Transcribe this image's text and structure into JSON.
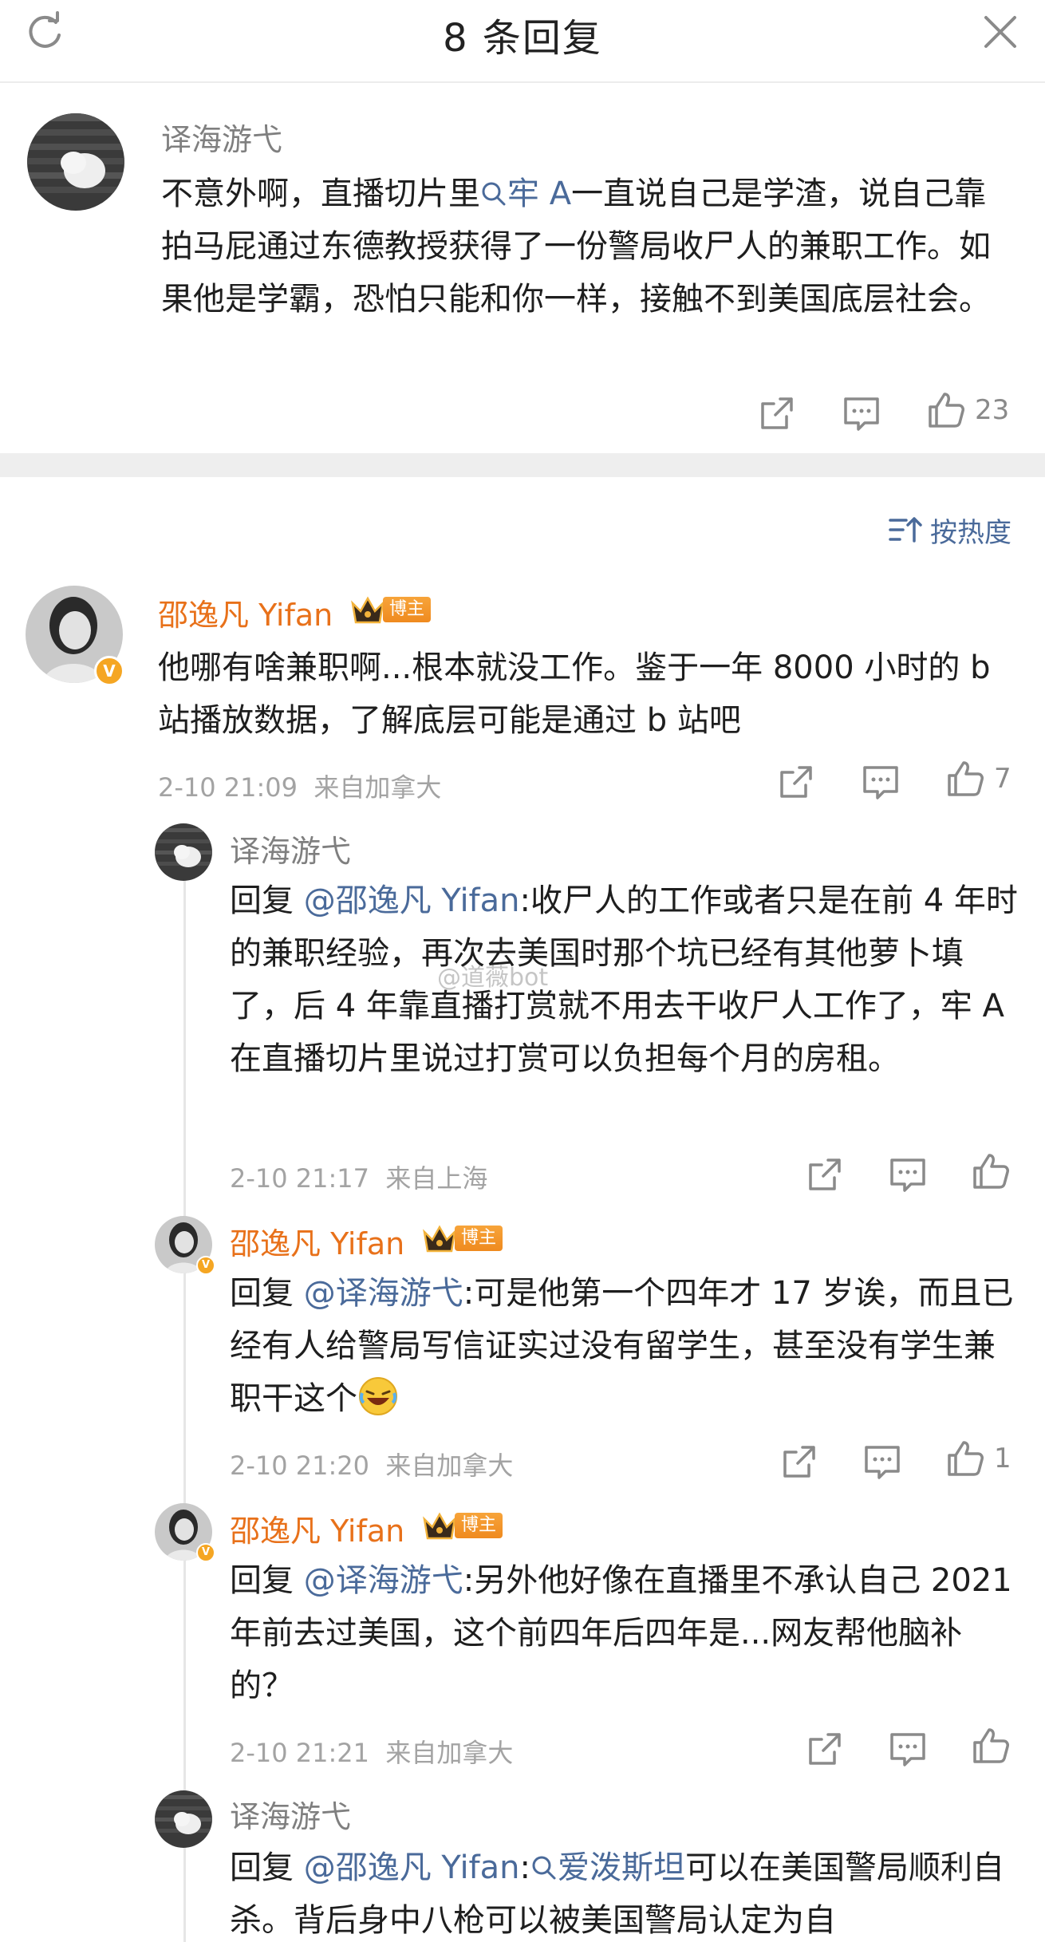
{
  "header": {
    "title": "8 条回复"
  },
  "main_comment": {
    "user": "译海游弋",
    "text_pre": "不意外啊，直播切片里",
    "link": "牢 A",
    "text_post": "一直说自己是学渣，说自己靠拍马屁通过东德教授获得了一份警局收尸人的兼职工作。如果他是学霸，恐怕只能和你一样，接触不到美国底层社会。",
    "likes": "23"
  },
  "sort": {
    "label": "按热度"
  },
  "replies": [
    {
      "user": "邵逸凡 Yifan",
      "badge": "博主",
      "text": "他哪有啥兼职啊...根本就没工作。鉴于一年 8000 小时的 b 站播放数据，了解底层可能是通过 b 站吧",
      "date": "2-10 21:09",
      "location": "来自加拿大",
      "likes": "7"
    },
    {
      "user": "译海游弋",
      "reply_prefix": "回复 ",
      "mention": "@邵逸凡 Yifan",
      "text": ":收尸人的工作或者只是在前 4 年时的兼职经验，再次去美国时那个坑已经有其他萝卜填了，后 4 年靠直播打赏就不用去干收尸人工作了，牢 A 在直播切片里说过打赏可以负担每个月的房租。",
      "date": "2-10 21:17",
      "location": "来自上海",
      "likes": ""
    },
    {
      "user": "邵逸凡 Yifan",
      "badge": "博主",
      "reply_prefix": "回复 ",
      "mention": "@译海游弋",
      "text": ":可是他第一个四年才 17 岁诶，而且已经有人给警局写信证实过没有留学生，甚至没有学生兼职干这个",
      "date": "2-10 21:20",
      "location": "来自加拿大",
      "likes": "1"
    },
    {
      "user": "邵逸凡 Yifan",
      "badge": "博主",
      "reply_prefix": "回复 ",
      "mention": "@译海游弋",
      "text": ":另外他好像在直播里不承认自己 2021年前去过美国，这个前四年后四年是...网友帮他脑补的？",
      "date": "2-10 21:21",
      "location": "来自加拿大",
      "likes": ""
    },
    {
      "user": "译海游弋",
      "reply_prefix": "回复 ",
      "mention": "@邵逸凡 Yifan",
      "sep": ":",
      "link": "爱泼斯坦",
      "text": "可以在美国警局顺利自杀。背后身中八枪可以被美国警局认定为自"
    }
  ],
  "watermark": "@道薇bot",
  "icons": {
    "refresh": "refresh-icon",
    "close": "close-icon",
    "share": "share-icon",
    "comment": "comment-icon",
    "like": "like-icon",
    "search": "search-icon",
    "sort": "sort-icon",
    "verified": "verified-icon",
    "crown": "crown-icon",
    "laugh": "laughing-emoji-icon"
  },
  "colors": {
    "orange": "#e8711a",
    "link": "#4a6a9a",
    "badge": "#ef8a1f"
  }
}
